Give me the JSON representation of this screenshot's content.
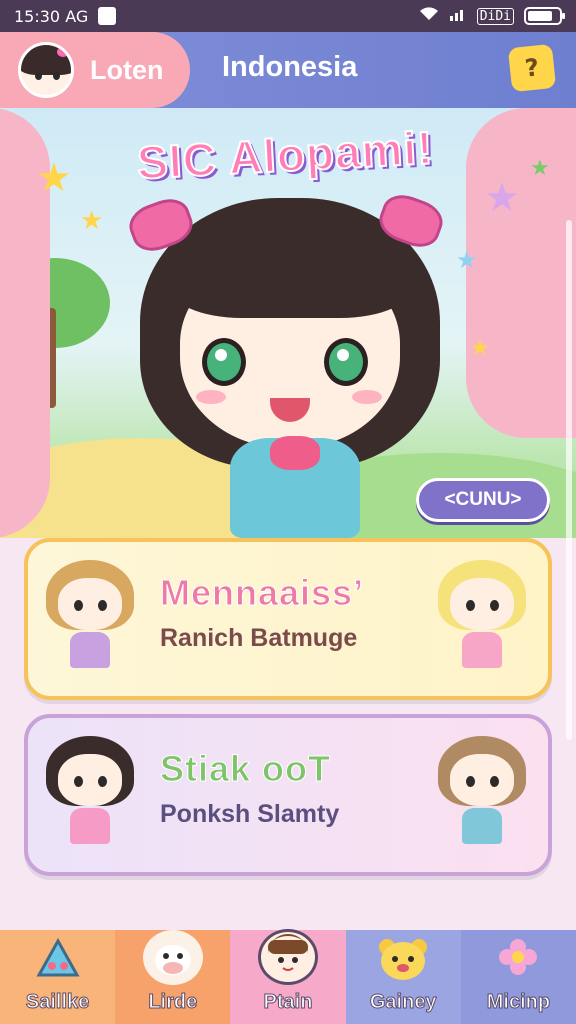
{
  "status_bar": {
    "time": "15:30 AG",
    "signal_text": "DiDi",
    "battery_level": 0.8
  },
  "header": {
    "login_label": "Loten",
    "title": "Indonesia",
    "help_label": "?"
  },
  "hero": {
    "title": "SIC Alopami!",
    "continue_label": "<CUNU>"
  },
  "cards": [
    {
      "title": "Mennaaiss’",
      "subtitle": "Ranich Batmuge"
    },
    {
      "title": "Stiak ooT",
      "subtitle": "Ponksh Slamty"
    }
  ],
  "bottom_nav": [
    {
      "label": "Saillke",
      "icon": "triangle-gem-icon",
      "color": "#f9b47a"
    },
    {
      "label": "Lirde",
      "icon": "cow-face-icon",
      "color": "#f7a26b"
    },
    {
      "label": "Ptain",
      "icon": "boy-face-icon",
      "color": "#f6a9c8"
    },
    {
      "label": "Gainey",
      "icon": "bear-face-icon",
      "color": "#9ba5e2"
    },
    {
      "label": "Micinp",
      "icon": "flower-icon",
      "color": "#8f99dc"
    }
  ]
}
